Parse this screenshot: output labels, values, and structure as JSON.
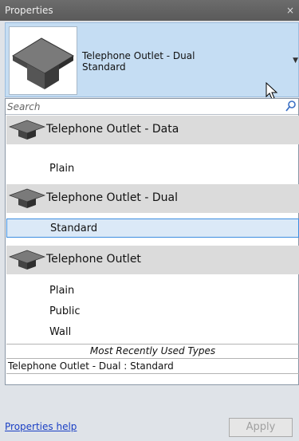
{
  "window": {
    "title": "Properties",
    "close_glyph": "×"
  },
  "selected_type": {
    "family": "Telephone Outlet - Dual",
    "type": "Standard",
    "thumbnail_icon": "telephone-outlet-icon"
  },
  "search": {
    "placeholder": "Search",
    "icon": "search-icon"
  },
  "type_list": [
    {
      "family": "Telephone Outlet - Data",
      "types": [
        "Plain"
      ]
    },
    {
      "family": "Telephone Outlet - Dual",
      "types": [
        "Standard"
      ]
    },
    {
      "family": "Telephone Outlet",
      "types": [
        "Plain",
        "Public",
        "Wall"
      ]
    }
  ],
  "selected_item": "Standard",
  "mru": {
    "header": "Most Recently Used Types",
    "items": [
      "Telephone Outlet - Dual : Standard"
    ]
  },
  "footer": {
    "help_link": "Properties help",
    "apply_label": "Apply"
  },
  "colors": {
    "header_bg": "#c5ddf3",
    "selection_border": "#3d8ee0",
    "link": "#1a3fc4"
  }
}
